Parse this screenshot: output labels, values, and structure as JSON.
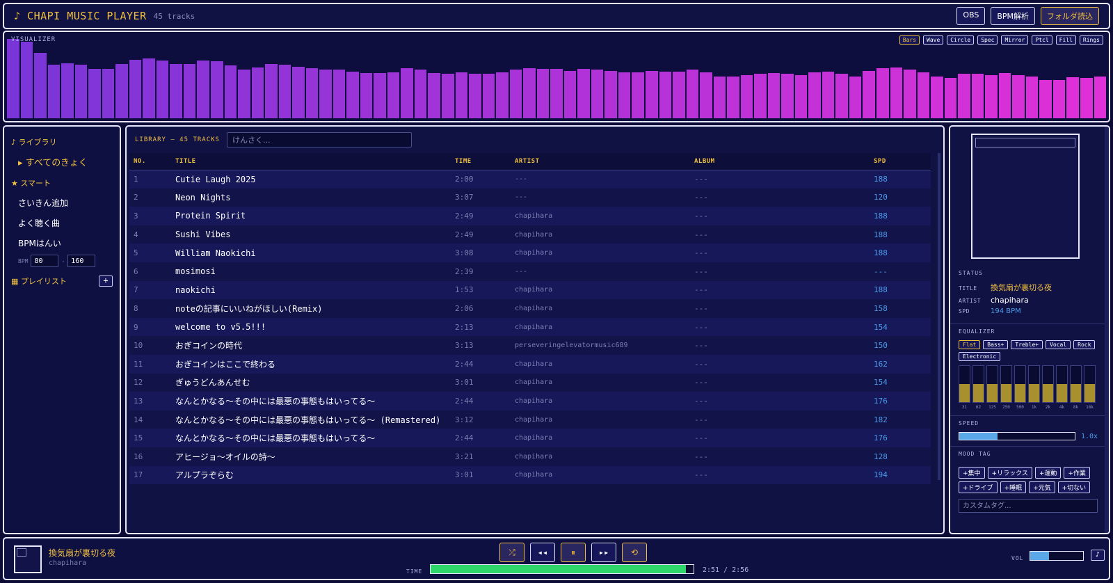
{
  "header": {
    "logo": "♪ CHAPI MUSIC PLAYER",
    "track_count": "45 tracks",
    "buttons": [
      {
        "label": "OBS",
        "accent": false
      },
      {
        "label": "BPM解析",
        "accent": false
      },
      {
        "label": "フォルダ読込",
        "accent": true
      }
    ]
  },
  "visualizer": {
    "label": "VISUALIZER",
    "modes": [
      "Bars",
      "Wave",
      "Circle",
      "Spec",
      "Mirror",
      "Ptcl",
      "Fill",
      "Rings"
    ],
    "active_mode": "Bars",
    "levels": [
      0.95,
      0.92,
      0.78,
      0.64,
      0.66,
      0.64,
      0.59,
      0.59,
      0.65,
      0.7,
      0.72,
      0.69,
      0.65,
      0.65,
      0.69,
      0.68,
      0.63,
      0.58,
      0.61,
      0.65,
      0.64,
      0.62,
      0.6,
      0.58,
      0.58,
      0.56,
      0.54,
      0.54,
      0.55,
      0.6,
      0.58,
      0.54,
      0.53,
      0.55,
      0.53,
      0.53,
      0.55,
      0.58,
      0.6,
      0.59,
      0.59,
      0.57,
      0.59,
      0.58,
      0.57,
      0.55,
      0.55,
      0.57,
      0.56,
      0.56,
      0.58,
      0.55,
      0.5,
      0.5,
      0.52,
      0.53,
      0.54,
      0.53,
      0.52,
      0.55,
      0.56,
      0.53,
      0.5,
      0.57,
      0.6,
      0.61,
      0.58,
      0.55,
      0.5,
      0.48,
      0.53,
      0.53,
      0.52,
      0.54,
      0.52,
      0.5,
      0.46,
      0.46,
      0.49,
      0.48,
      0.5
    ],
    "color_start": "#7a35d8",
    "color_end": "#e030d8"
  },
  "sidebar": {
    "library_head": "♪ ライブラリ",
    "all_tracks": "▸ すべてのきょく",
    "smart_head": "★ スマート",
    "smart_items": [
      "さいきん追加",
      "よく聴く曲",
      "BPMはんい"
    ],
    "bpm_label": "BPM",
    "bpm_min": "80",
    "bpm_sep": "-",
    "bpm_max": "160",
    "playlist_head": "▦ プレイリスト",
    "add_label": "+"
  },
  "library": {
    "title": "LIBRARY — 45 TRACKS",
    "search_placeholder": "けんさく...",
    "columns": [
      "NO.",
      "TITLE",
      "TIME",
      "ARTIST",
      "ALBUM",
      "SPD"
    ],
    "rows": [
      {
        "no": "1",
        "title": "Cutie Laugh 2025",
        "time": "2:00",
        "artist": "---",
        "album": "---",
        "spd": "188"
      },
      {
        "no": "2",
        "title": "Neon Nights",
        "time": "3:07",
        "artist": "---",
        "album": "---",
        "spd": "120"
      },
      {
        "no": "3",
        "title": "Protein Spirit",
        "time": "2:49",
        "artist": "chapihara",
        "album": "---",
        "spd": "188"
      },
      {
        "no": "4",
        "title": "Sushi Vibes",
        "time": "2:49",
        "artist": "chapihara",
        "album": "---",
        "spd": "188"
      },
      {
        "no": "5",
        "title": "William Naokichi",
        "time": "3:08",
        "artist": "chapihara",
        "album": "---",
        "spd": "188"
      },
      {
        "no": "6",
        "title": "mosimosi",
        "time": "2:39",
        "artist": "---",
        "album": "---",
        "spd": "---"
      },
      {
        "no": "7",
        "title": "naokichi",
        "time": "1:53",
        "artist": "chapihara",
        "album": "---",
        "spd": "188"
      },
      {
        "no": "8",
        "title": "noteの記事にいいねがほしい(Remix)",
        "time": "2:06",
        "artist": "chapihara",
        "album": "---",
        "spd": "158"
      },
      {
        "no": "9",
        "title": "welcome to v5.5!!!",
        "time": "2:13",
        "artist": "chapihara",
        "album": "---",
        "spd": "154"
      },
      {
        "no": "10",
        "title": "おぎコインの時代",
        "time": "3:13",
        "artist": "perseveringelevatormusic689",
        "album": "---",
        "spd": "150"
      },
      {
        "no": "11",
        "title": "おぎコインはここで終わる",
        "time": "2:44",
        "artist": "chapihara",
        "album": "---",
        "spd": "162"
      },
      {
        "no": "12",
        "title": "ぎゅうどんあんせむ",
        "time": "3:01",
        "artist": "chapihara",
        "album": "---",
        "spd": "154"
      },
      {
        "no": "13",
        "title": "なんとかなる〜その中には最悪の事態もはいってる〜",
        "time": "2:44",
        "artist": "chapihara",
        "album": "---",
        "spd": "176"
      },
      {
        "no": "14",
        "title": "なんとかなる〜その中には最悪の事態もはいってる〜 (Remastered)",
        "time": "3:12",
        "artist": "chapihara",
        "album": "---",
        "spd": "182"
      },
      {
        "no": "15",
        "title": "なんとかなる〜その中には最悪の事態もはいってる〜",
        "time": "2:44",
        "artist": "chapihara",
        "album": "---",
        "spd": "176"
      },
      {
        "no": "16",
        "title": "アヒージョ〜オイルの詩〜",
        "time": "3:21",
        "artist": "chapihara",
        "album": "---",
        "spd": "128"
      },
      {
        "no": "17",
        "title": "アルプラぞらむ",
        "time": "3:01",
        "artist": "chapihara",
        "album": "---",
        "spd": "194"
      }
    ]
  },
  "status": {
    "head": "STATUS",
    "title_label": "TITLE",
    "title": "換気扇が裏切る夜",
    "artist_label": "ARTIST",
    "artist": "chapihara",
    "spd_label": "SPD",
    "spd": "194 BPM"
  },
  "equalizer": {
    "head": "EQUALIZER",
    "presets": [
      "Flat",
      "Bass+",
      "Treble+",
      "Vocal",
      "Rock",
      "Electronic"
    ],
    "active_preset": "Flat",
    "bands": [
      "31",
      "62",
      "125",
      "250",
      "500",
      "1k",
      "2k",
      "4k",
      "8k",
      "16k"
    ],
    "levels": [
      0.5,
      0.5,
      0.5,
      0.5,
      0.5,
      0.5,
      0.5,
      0.5,
      0.5,
      0.5
    ]
  },
  "speed": {
    "head": "SPEED",
    "value": "1.0x",
    "level": 0.33
  },
  "mood": {
    "head": "MOOD TAG",
    "tags": [
      "+集中",
      "+リラックス",
      "+運動",
      "+作業",
      "+ドライブ",
      "+睡眠",
      "+元気",
      "+切ない"
    ],
    "custom_placeholder": "カスタムタグ..."
  },
  "player": {
    "title": "換気扇が裏切る夜",
    "artist": "chapihara",
    "time_label": "TIME",
    "time_text": "2:51 / 2:56",
    "progress": 0.97,
    "vol_label": "VOL",
    "volume": 0.35,
    "vol_icon": "♪",
    "controls": [
      {
        "name": "shuffle-button",
        "glyph": "⤮",
        "accent": true
      },
      {
        "name": "previous-button",
        "glyph": "◂◂",
        "accent": false
      },
      {
        "name": "pause-button",
        "glyph": "⏸",
        "accent": true
      },
      {
        "name": "next-button",
        "glyph": "▸▸",
        "accent": false
      },
      {
        "name": "repeat-button",
        "glyph": "⟲",
        "accent": true
      }
    ]
  }
}
